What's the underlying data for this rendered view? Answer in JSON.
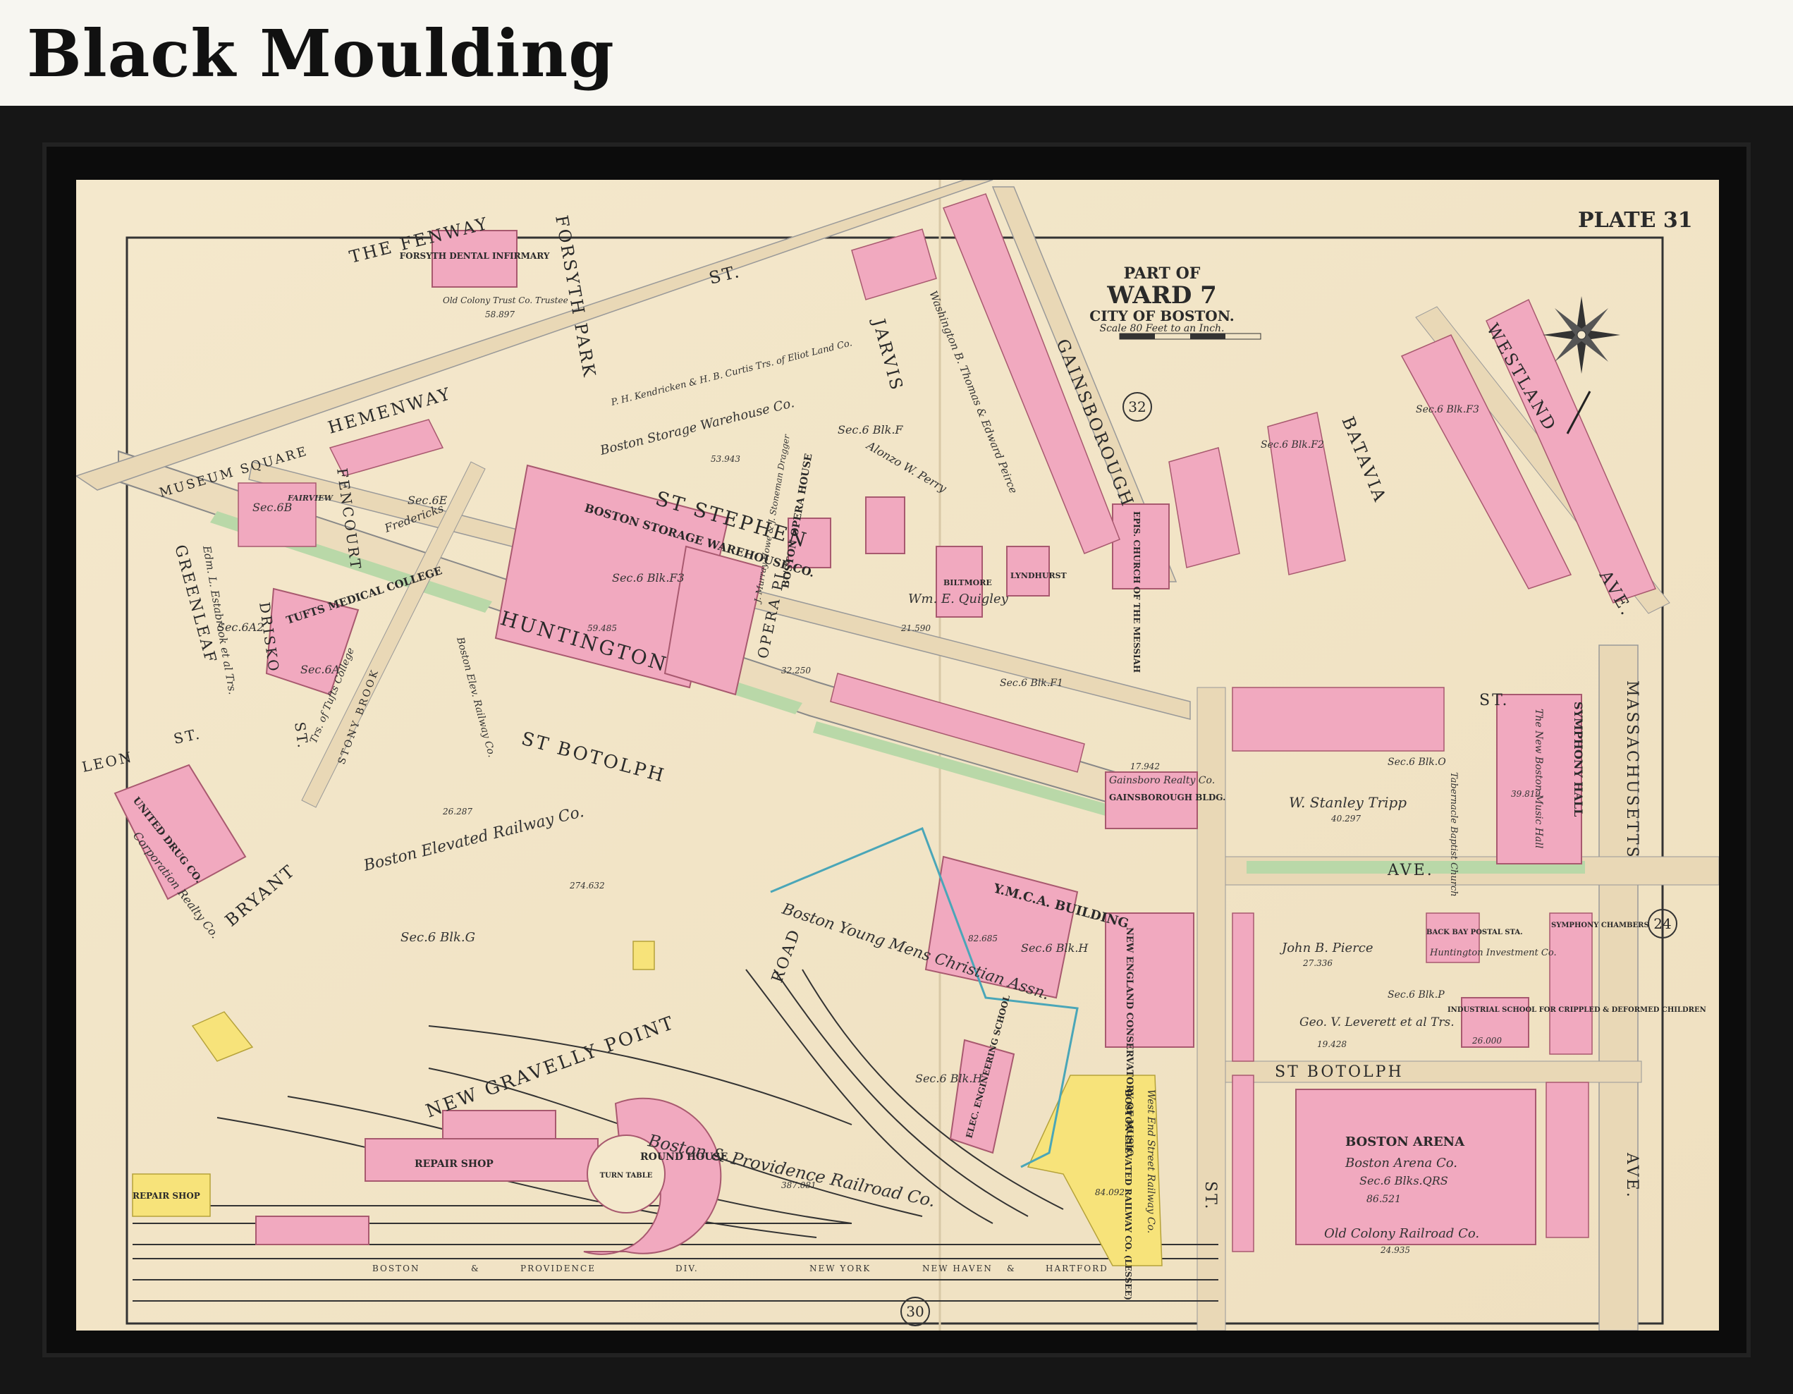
{
  "header": {
    "title": "Black Moulding"
  },
  "plate": {
    "number": "PLATE 31",
    "title_line1": "PART OF",
    "title_line2": "WARD 7",
    "title_line3": "CITY OF BOSTON.",
    "scale": "Scale 80 Feet to an Inch.",
    "adjacent_top": "32",
    "adjacent_right": "24",
    "adjacent_bottom": "30"
  },
  "streets": {
    "fenway": "THE FENWAY",
    "forsyth_park": "FORSYTH  PARK",
    "hemenway": "HEMENWAY",
    "museum_square": "MUSEUM SQUARE",
    "fencourt": "FENCOURT",
    "st_top": "ST.",
    "jarvis": "JARVIS",
    "gainsborough": "GAINSBOROUGH",
    "batavia": "BATAVIA",
    "westland": "WESTLAND",
    "ave_top": "AVE.",
    "st_stephen": "ST STEPHEN",
    "huntington": "HUNTINGTON",
    "opera_pl": "OPERA  PL",
    "greenleaf": "GREENLEAF",
    "drisko": "DRISKO",
    "st_drisko": "ST.",
    "leon": "LEON",
    "st_leon": "ST.",
    "st_botolph": "ST BOTOLPH",
    "bryant": "BRYANT",
    "stony_brook": "STONY BROOK",
    "road": "ROAD",
    "new_gravelly_point": "NEW GRAVELLY POINT",
    "massachusetts": "MASSACHUSETTS",
    "ave_mass": "AVE.",
    "st_mid": "ST.",
    "ave_huntington": "AVE.",
    "st_botolph_lower": "ST BOTOLPH",
    "st_lower": "ST."
  },
  "buildings": {
    "forsyth_dental": "FORSYTH DENTAL INFIRMARY",
    "forsyth_owner": "Old Colony Trust Co. Trustee",
    "forsyth_area": "58.897",
    "boston_storage": "BOSTON STORAGE WAREHOUSE CO.",
    "boston_storage_sec": "Sec.6 Blk.F3",
    "boston_storage_area": "59.485",
    "storage_warehouse_label": "Boston Storage Warehouse Co.",
    "storage_area2": "53.943",
    "opera_house": "BOSTON OPERA HOUSE",
    "opera_owner": "J. Murray Howe & J. Stoneman Dragger",
    "opera_area": "32.250",
    "tufts": "TUFTS MEDICAL COLLEGE",
    "tufts_sec": "Sec.6A",
    "tufts_owner": "Trs. of Tufts College",
    "symphony_hall": "SYMPHONY HALL",
    "symphony_owner": "The New Boston Music Hall",
    "symphony_area": "39.819",
    "ymca": "Y.M.C.A. BUILDING",
    "ymca_area": "82.685",
    "ymca_sec": "Sec.6 Blk.H",
    "ymca_owner": "Boston Young Mens Christian Assn.",
    "conservatory": "NEW ENGLAND CONSERVATORY OF MUSIC",
    "elec_school": "ELEC. ENGINEERING SCHOOL",
    "elec_sec": "Sec.6 Blk.H",
    "boston_arena": "BOSTON ARENA",
    "arena_owner": "Boston Arena Co.",
    "arena_sec": "Sec.6 Blks.QRS",
    "arena_area": "86.521",
    "industrial_school": "INDUSTRIAL SCHOOL FOR CRIPPLED & DEFORMED CHILDREN",
    "industrial_area": "26.000",
    "gainsboro_bldg": "GAINSBOROUGH BLDG.",
    "gainsboro_owner": "Gainsboro Realty Co.",
    "gainsboro_area": "17.942",
    "church_messiah": "EPIS. CHURCH OF THE MESSIAH",
    "united_drug": "UNITED DRUG CO.",
    "united_owner": "Corporation Realty Co.",
    "repair_shop": "REPAIR SHOP",
    "repair_shop2": "REPAIR SHOP",
    "round_house": "ROUND HOUSE",
    "turn_table": "TURN TABLE",
    "round_house_area": "387.081",
    "elevated_lessee": "BOSTON ELEVATED RAILWAY CO. (LESSEE)",
    "west_end": "West End Street Railway Co.",
    "west_end_area": "84.092",
    "biltmore": "BILTMORE",
    "lyndhurst": "LYNDHURST",
    "back_bay_postal": "BACK BAY POSTAL STA.",
    "huntington_investment": "Huntington Investment Co.",
    "symphony_chambers": "SYMPHONY CHAMBERS"
  },
  "owners": {
    "elevated_railway": "Boston Elevated Railway Co.",
    "elevated_area": "274.632",
    "elevated_short": "Boston Elev. Railway Co.",
    "elevated_short_area": "26.287",
    "sec_6g": "Sec.6 Blk.G",
    "boston_providence": "Boston & Providence Railroad Co.",
    "old_colony": "Old Colony Railroad Co.",
    "old_colony_area": "24.935",
    "stanley_tripp": "W. Stanley Tripp",
    "tripp_area": "40.297",
    "sec_6o": "Sec.6 Blk.O",
    "tabernacle": "Tabernacle Baptist Church",
    "john_pierce": "John B. Pierce",
    "pierce_area": "27.336",
    "sec_6p": "Sec.6 Blk.P",
    "leverett": "Geo. V. Leverett et al Trs.",
    "leverett_area": "19.428",
    "quigley": "Wm. E. Quigley",
    "quigley_area": "21.590",
    "sec_6f": "Sec.6 Blk.F",
    "alonzo_perry": "Alonzo W. Perry",
    "thomas_peirce": "Washington B. Thomas & Edward Peirce",
    "kendricken": "P. H. Kendricken & H. B. Curtis Trs. of Eliot Land Co.",
    "estabrook": "Edm. L. Estabrook et al Trs.",
    "sec_6a2": "Sec.6A2",
    "sec_6b": "Sec.6B",
    "sec_6e": "Sec.6E",
    "fredericks": "Fredericks",
    "fairview": "FAIRVIEW",
    "sec_6f2": "Sec.6 Blk.F2",
    "sec_6f3": "Sec.6 Blk.F3",
    "sec_6f1": "Sec.6 Blk.F1",
    "sec_6q": "Sec.6 Blk.G",
    "rail_boston": "BOSTON",
    "rail_providence": "PROVIDENCE",
    "rail_div": "DIV.",
    "rail_ny": "NEW YORK",
    "rail_nh": "NEW HAVEN",
    "rail_amp": "&",
    "rail_hartford": "HARTFORD"
  }
}
